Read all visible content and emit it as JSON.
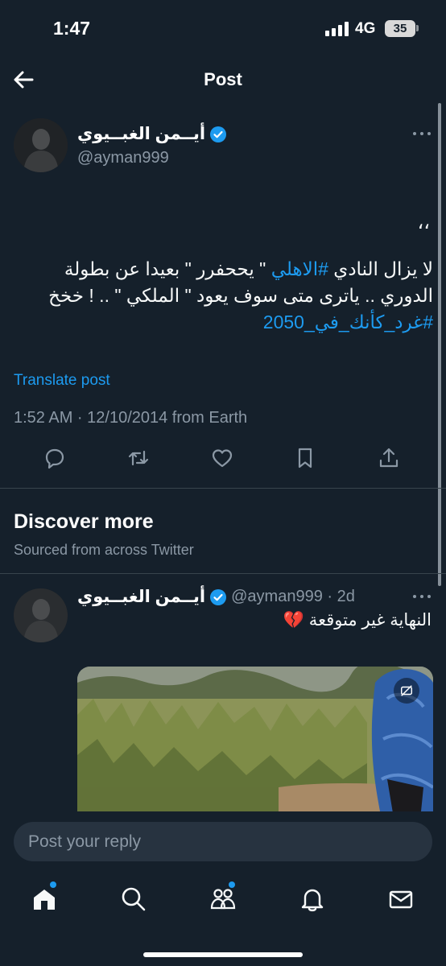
{
  "status_bar": {
    "time": "1:47",
    "network": "4G",
    "battery": "35"
  },
  "header": {
    "title": "Post"
  },
  "post": {
    "author_name": "أيــمن الغبــيوي",
    "handle": "@ayman999",
    "quote_mark": "،،",
    "line1_pre": "لا يزال النادي ",
    "line1_hashtag": "#الاهلي",
    "line1_post": " \" يححفرر \" بعيدا عن بطولة",
    "line2": "الدوري .. ياترى متى سوف يعود \" الملكي \" .. ! خخخ",
    "line3_hashtag": "#غرد_كأنك_في_2050",
    "translate_label": "Translate post",
    "meta": "1:52 AM · 12/10/2014 from Earth"
  },
  "actions": {
    "reply_icon": "reply-icon",
    "repost_icon": "repost-icon",
    "like_icon": "heart-icon",
    "bookmark_icon": "bookmark-icon",
    "share_icon": "share-icon"
  },
  "discover": {
    "title": "Discover more",
    "subtitle": "Sourced from across Twitter",
    "item": {
      "author_name": "أيــمن الغبــيوي",
      "handle_time": "@ayman999 · 2d",
      "text": "النهاية غير متوقعة 💔"
    }
  },
  "reply": {
    "placeholder": "Post your reply"
  },
  "colors": {
    "background": "#15202b",
    "accent": "#1d9bf0",
    "muted": "#8b98a5",
    "divider": "#38444d"
  }
}
